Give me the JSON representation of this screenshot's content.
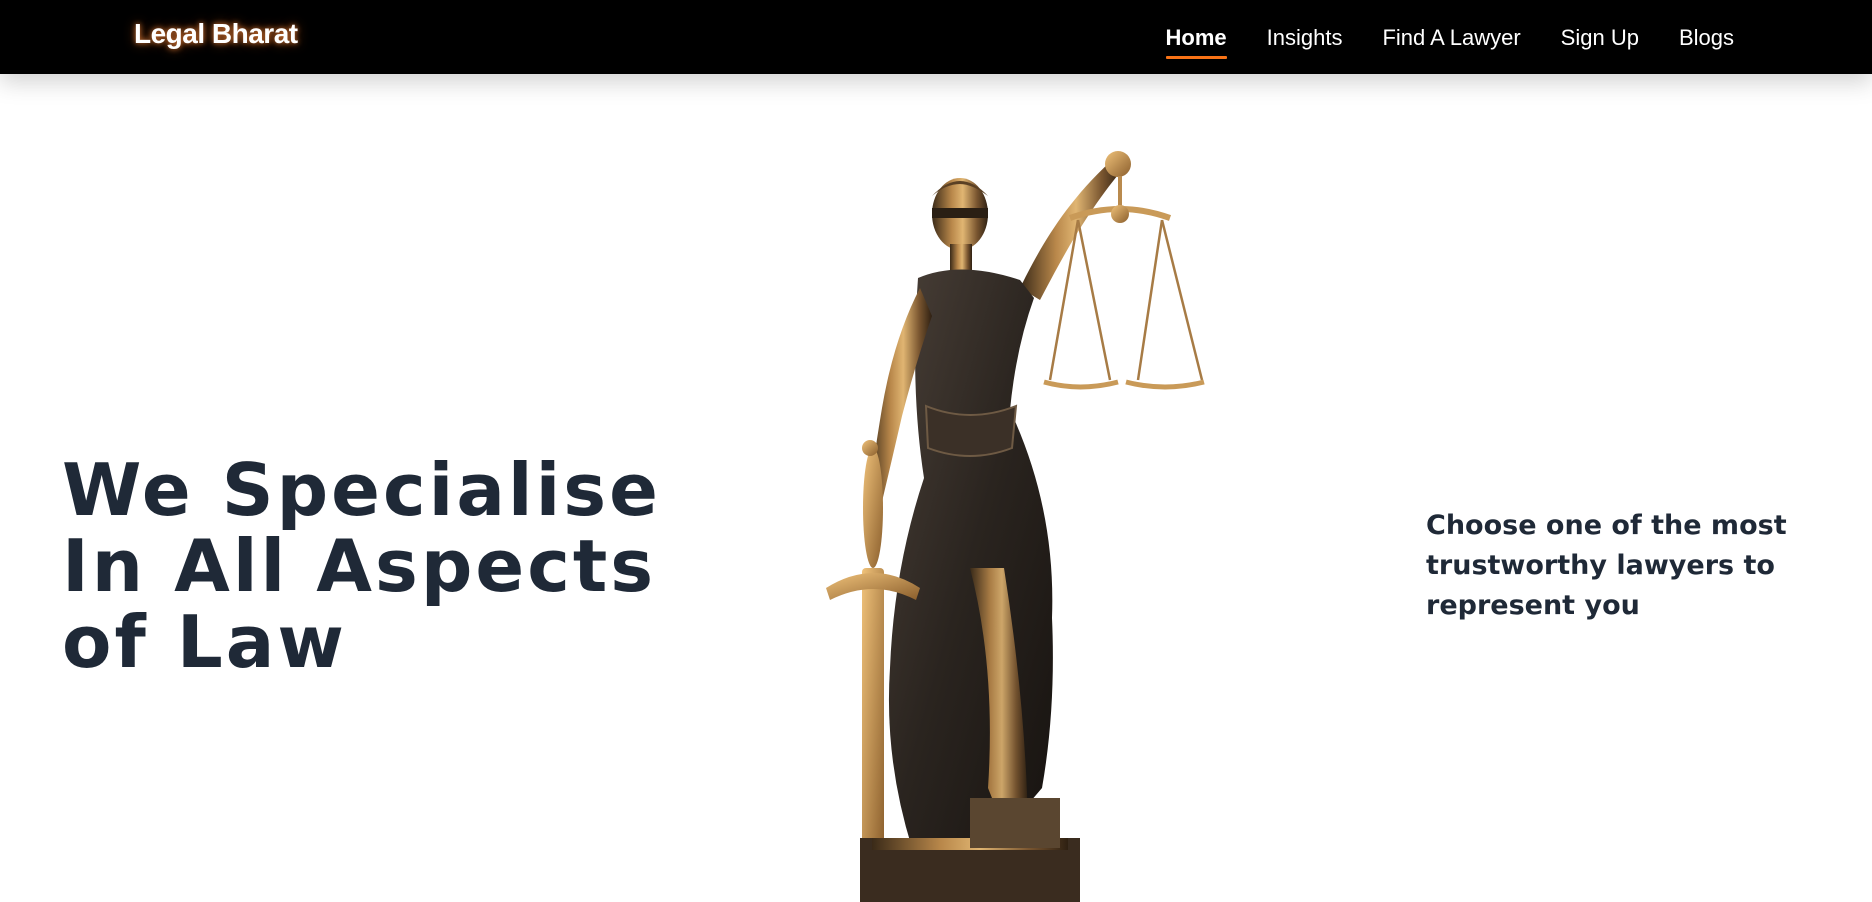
{
  "navbar": {
    "brand": "Legal Bharat",
    "links": [
      {
        "label": "Home",
        "active": true
      },
      {
        "label": "Insights",
        "active": false
      },
      {
        "label": "Find A Lawyer",
        "active": false
      },
      {
        "label": "Sign Up",
        "active": false
      },
      {
        "label": "Blogs",
        "active": false
      }
    ],
    "accent_color": "#f97316"
  },
  "hero": {
    "title_lines": [
      "We Specialise",
      "In All Aspects",
      "of Law"
    ],
    "tagline": "Choose one of the most trustworthy lawyers to represent you",
    "text_color": "#1f2937",
    "image": "lady-justice-statue"
  }
}
